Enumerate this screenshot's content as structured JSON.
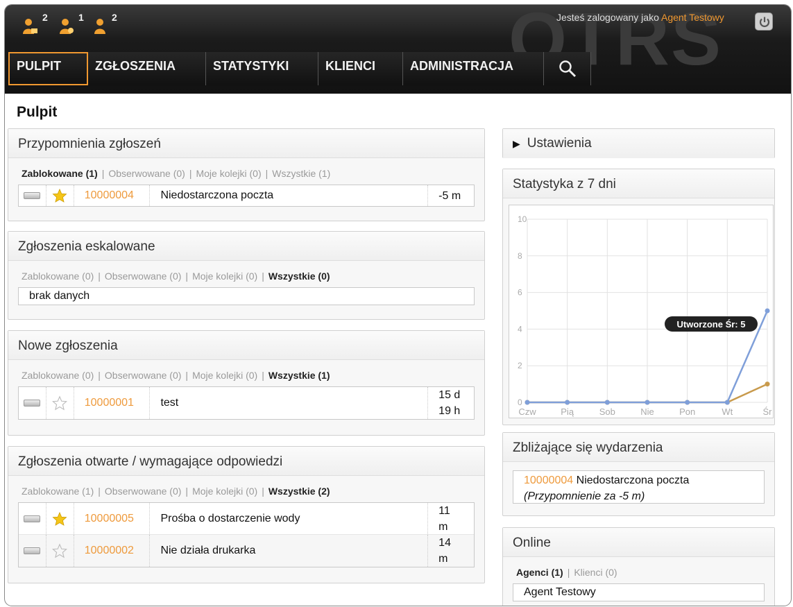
{
  "header": {
    "watermark": "OTRS",
    "toolbar": [
      {
        "icon": "locked-tickets-icon",
        "count": "2"
      },
      {
        "icon": "watched-tickets-icon",
        "count": "1"
      },
      {
        "icon": "responsible-tickets-icon",
        "count": "2"
      }
    ],
    "login_prefix": "Jesteś zalogowany jako ",
    "agent_name": "Agent Testowy",
    "logout_icon": "power-icon",
    "nav": [
      "PULPIT",
      "ZGŁOSZENIA",
      "STATYSTYKI",
      "KLIENCI",
      "ADMINISTRACJA"
    ],
    "search_icon": "search-icon",
    "accent_color": "#f09830"
  },
  "page_title": "Pulpit",
  "reminders": {
    "title": "Przypomnienia zgłoszeń",
    "filters": [
      {
        "label": "Zablokowane (1)",
        "active": true
      },
      {
        "label": "Obserwowane (0)",
        "active": false
      },
      {
        "label": "Moje kolejki (0)",
        "active": false
      },
      {
        "label": "Wszystkie (1)",
        "active": false
      }
    ],
    "rows": [
      {
        "starred": true,
        "number": "10000004",
        "title": "Niedostarczona poczta",
        "age": "-5 m"
      }
    ]
  },
  "escalated": {
    "title": "Zgłoszenia eskalowane",
    "filters": [
      {
        "label": "Zablokowane (0)",
        "active": false
      },
      {
        "label": "Obserwowane (0)",
        "active": false
      },
      {
        "label": "Moje kolejki (0)",
        "active": false
      },
      {
        "label": "Wszystkie (0)",
        "active": true
      }
    ],
    "empty_text": "brak danych"
  },
  "new_tickets": {
    "title": "Nowe zgłoszenia",
    "filters": [
      {
        "label": "Zablokowane (0)",
        "active": false
      },
      {
        "label": "Obserwowane (0)",
        "active": false
      },
      {
        "label": "Moje kolejki (0)",
        "active": false
      },
      {
        "label": "Wszystkie (1)",
        "active": true
      }
    ],
    "rows": [
      {
        "starred": false,
        "number": "10000001",
        "title": "test",
        "age_line1": "15 d",
        "age_line2": "19 h"
      }
    ]
  },
  "open_tickets": {
    "title": "Zgłoszenia otwarte / wymagające odpowiedzi",
    "filters": [
      {
        "label": "Zablokowane (1)",
        "active": false
      },
      {
        "label": "Obserwowane (0)",
        "active": false
      },
      {
        "label": "Moje kolejki (0)",
        "active": false
      },
      {
        "label": "Wszystkie (2)",
        "active": true
      }
    ],
    "rows": [
      {
        "starred": true,
        "number": "10000005",
        "title": "Prośba o dostarczenie wody",
        "age_line1": "11",
        "age_line2": "m"
      },
      {
        "starred": false,
        "number": "10000002",
        "title": "Nie działa drukarka",
        "age_line1": "14",
        "age_line2": "m"
      }
    ]
  },
  "settings": {
    "label": "Ustawienia",
    "icon": "triangle-right-icon"
  },
  "stats": {
    "title": "Statystyka z 7 dni"
  },
  "chart_data": {
    "type": "line",
    "title": "",
    "categories": [
      "Czw",
      "Pią",
      "Sob",
      "Nie",
      "Pon",
      "Wt",
      "Śr"
    ],
    "series": [
      {
        "name": "",
        "color": "#7f9fd9",
        "values": [
          0,
          0,
          0,
          0,
          0,
          0,
          5
        ]
      },
      {
        "name": "",
        "color": "#c89a4c",
        "values": [
          0,
          0,
          0,
          0,
          0,
          0,
          1
        ]
      }
    ],
    "ylim": [
      0,
      10
    ],
    "yticks": [
      "0",
      "2",
      "4",
      "6",
      "8",
      "10"
    ],
    "grid": true,
    "tooltip": "Utworzone Śr: 5"
  },
  "events": {
    "title": "Zbliżające się wydarzenia",
    "number": "10000004",
    "text": " Niedostarczona poczta",
    "note": "(Przypomnienie za -5 m)"
  },
  "online": {
    "title": "Online",
    "filter_agents": "Agenci (1)",
    "filter_customers": "Klienci (0)",
    "agent": "Agent Testowy"
  }
}
